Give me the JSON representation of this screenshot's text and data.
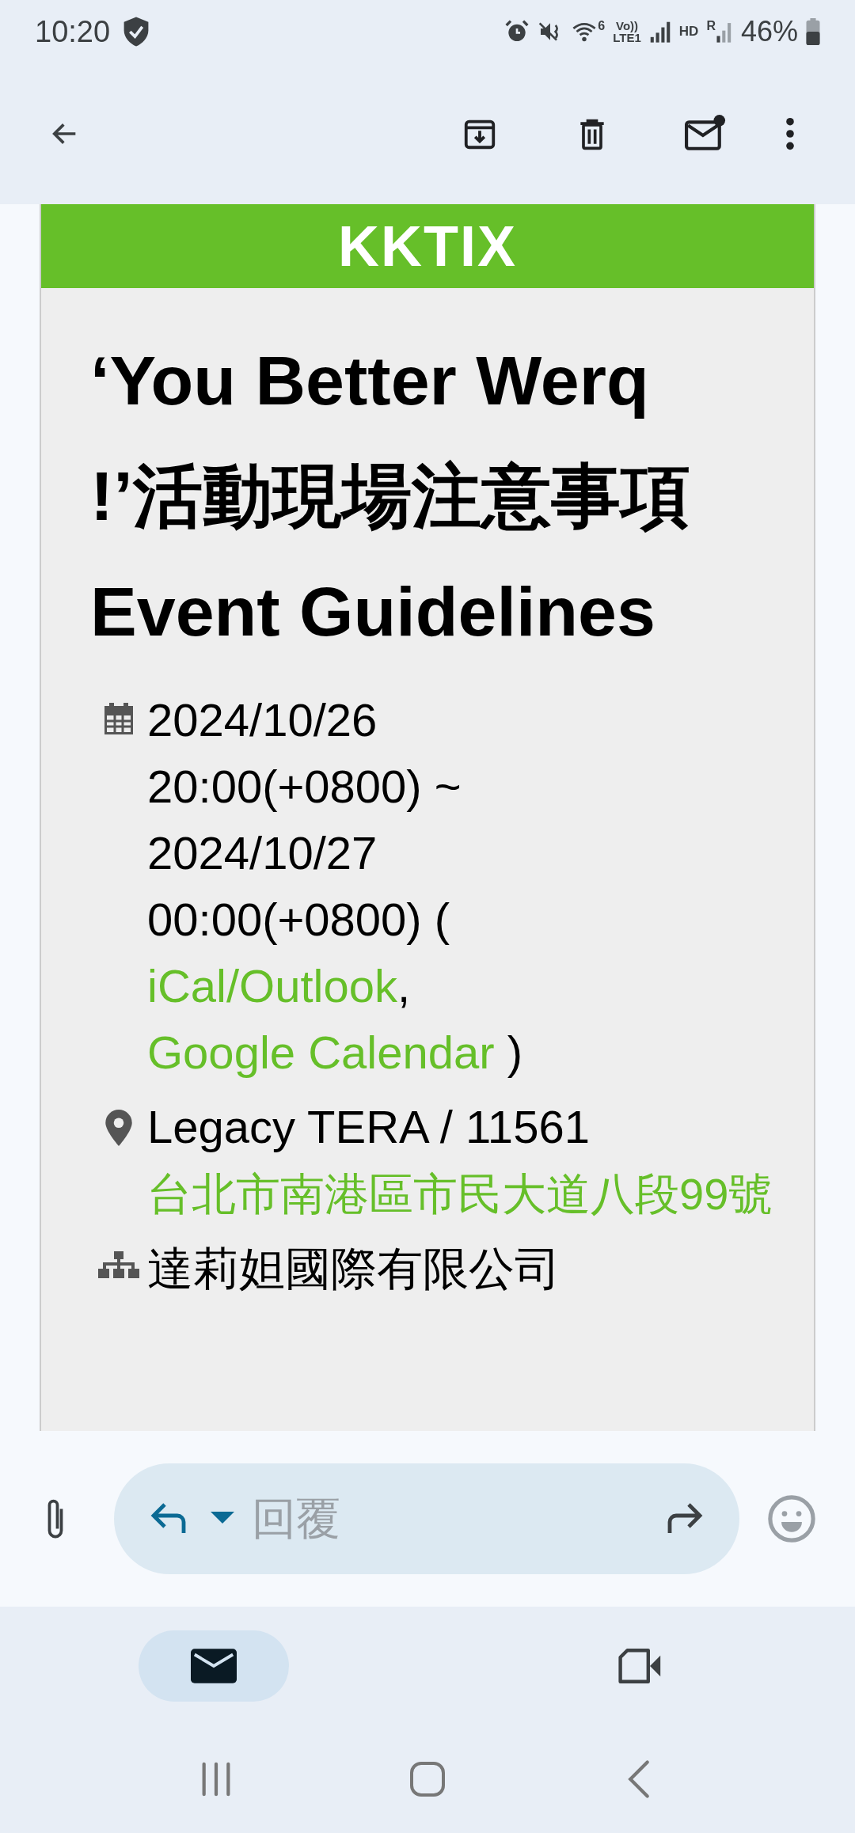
{
  "status_bar": {
    "time": "10:20",
    "wifi_label": "6",
    "volte_top": "Vo))",
    "volte_bottom": "LTE1",
    "hd": "HD",
    "roaming": "R",
    "battery": "46%"
  },
  "email": {
    "logo": "KKTIX",
    "title": "‘You Better Werq !’活動現場注意事項 Event Guidelines",
    "details": [
      {
        "kind": "date",
        "segments": [
          {
            "text": "2024/10/26 20:00(+0800) ~ 2024/10/27 00:00(+0800) (",
            "link": false,
            "block": true
          },
          {
            "text": "iCal/Outlook",
            "link": true
          },
          {
            "text": ", ",
            "link": false
          },
          {
            "text": "Google Calendar",
            "link": true
          },
          {
            "text": " )",
            "link": false
          }
        ]
      },
      {
        "kind": "place",
        "segments": [
          {
            "text": "Legacy TERA / 11561",
            "link": false
          },
          {
            "text": "台北市南港區市民大道八段99號",
            "link": true
          }
        ]
      },
      {
        "kind": "organizer",
        "segments": [
          {
            "text": "達莉妲國際有限公司",
            "link": false
          }
        ]
      }
    ]
  },
  "reply_bar": {
    "placeholder": "回覆"
  },
  "bottom_nav": [
    {
      "kind": "mail",
      "selected": true
    },
    {
      "kind": "video",
      "selected": false
    }
  ]
}
